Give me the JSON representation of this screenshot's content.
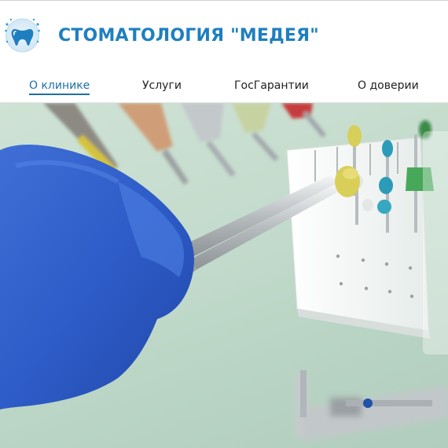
{
  "header": {
    "title": "СТОМАТОЛОГИЯ \"МЕДЕЯ\"",
    "logo_icon": "tooth-logo-icon"
  },
  "nav": {
    "items": [
      {
        "label": "О клинике",
        "active": true
      },
      {
        "label": "Услуги",
        "active": false
      },
      {
        "label": "ГосГарантии",
        "active": false
      },
      {
        "label": "О доверии",
        "active": false
      }
    ]
  },
  "hero": {
    "image_subject": "dental-instruments-photo"
  },
  "colors": {
    "brand_blue": "#1e7fc0",
    "nav_active": "#1e6fa8"
  }
}
